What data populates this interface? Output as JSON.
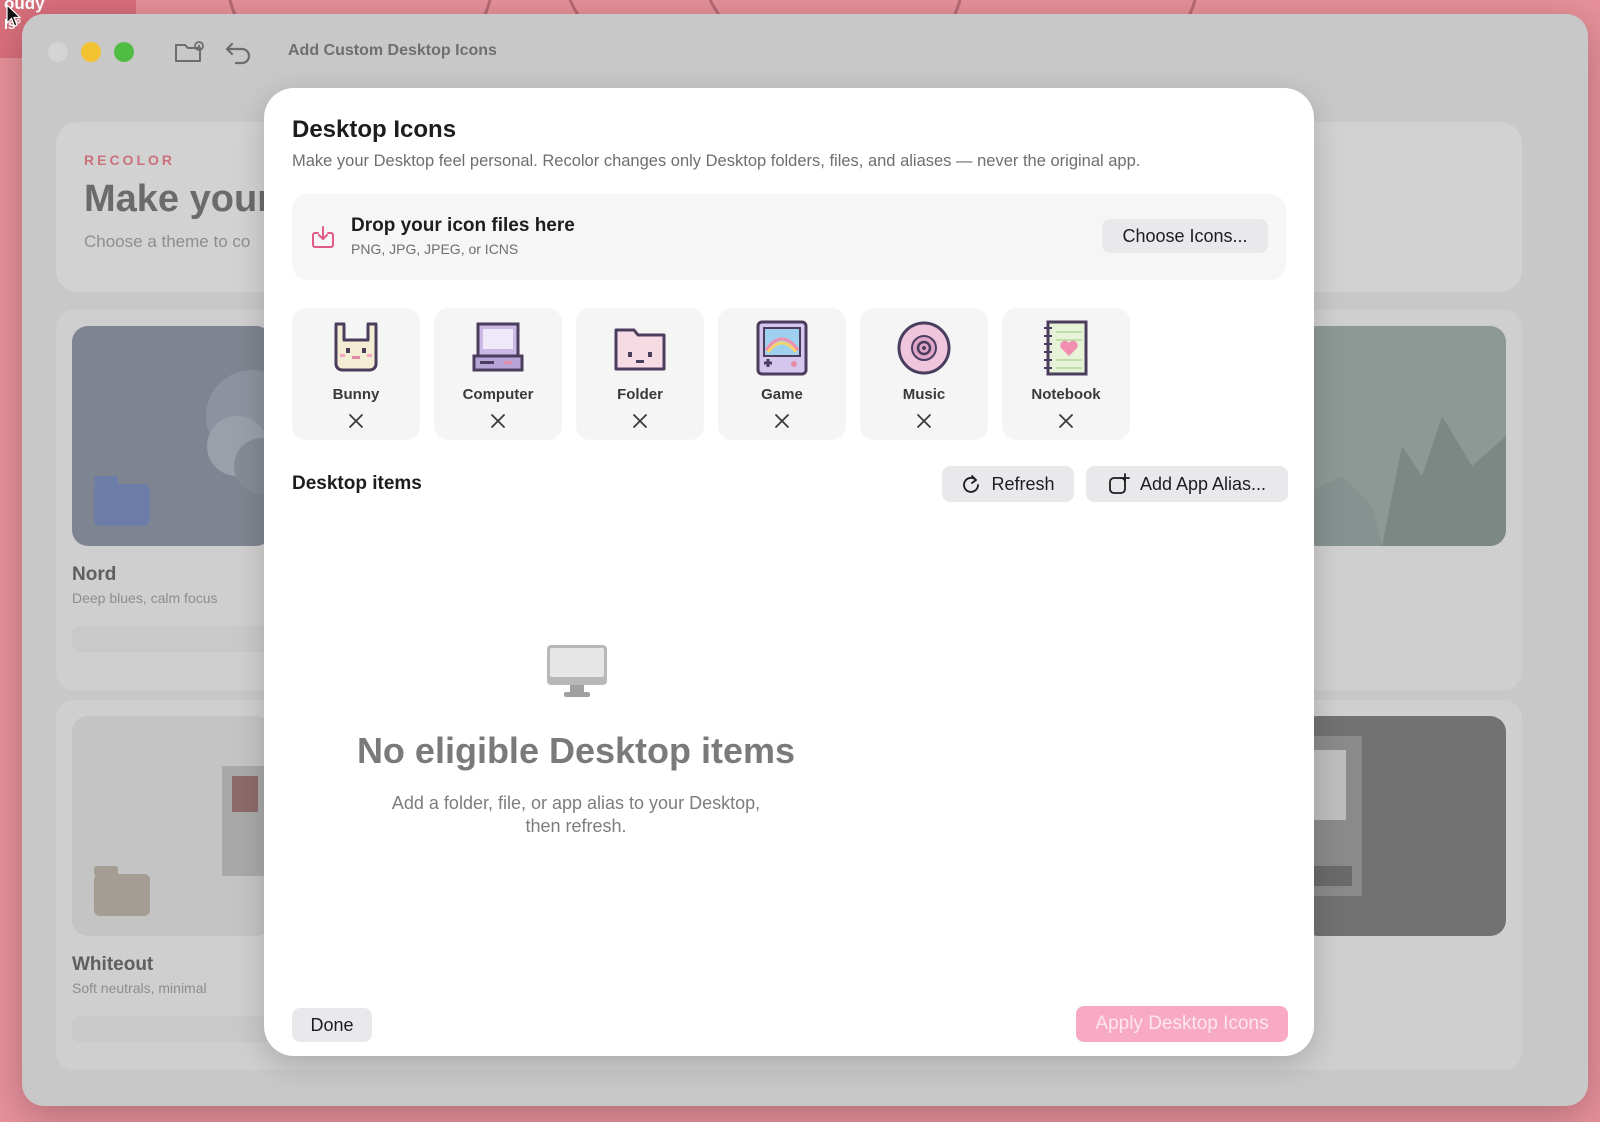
{
  "desktop": {
    "corner_text": "oudy",
    "corner_text2": "ls°"
  },
  "window": {
    "title": "Add Custom Desktop Icons"
  },
  "background": {
    "eyebrow": "RECOLOR",
    "headline": "Make your",
    "subtitle": "Choose a theme to co",
    "themes": [
      {
        "name": "Nord",
        "desc": "Deep blues, calm focus"
      },
      {
        "name": "Whiteout",
        "desc": "Soft neutrals, minimal"
      }
    ]
  },
  "sheet": {
    "title": "Desktop Icons",
    "description": "Make your Desktop feel personal. Recolor changes only Desktop folders, files, and aliases — never the original app.",
    "dropzone": {
      "title": "Drop your icon files here",
      "subtitle": "PNG, JPG, JPEG, or ICNS",
      "choose_label": "Choose Icons..."
    },
    "icons": [
      {
        "label": "Bunny",
        "icon": "bunny-icon"
      },
      {
        "label": "Computer",
        "icon": "computer-icon"
      },
      {
        "label": "Folder",
        "icon": "folder-icon"
      },
      {
        "label": "Game",
        "icon": "game-icon"
      },
      {
        "label": "Music",
        "icon": "music-icon"
      },
      {
        "label": "Notebook",
        "icon": "notebook-icon"
      }
    ],
    "items_section": {
      "title": "Desktop items",
      "refresh_label": "Refresh",
      "alias_label": "Add App Alias..."
    },
    "empty_state": {
      "icon": "desktop-computer-icon",
      "title": "No eligible Desktop items",
      "line1": "Add a folder, file, or app alias to your Desktop,",
      "line2": "then refresh."
    },
    "done_label": "Done",
    "apply_label": "Apply Desktop Icons"
  },
  "colors": {
    "accent": "#e05a8a",
    "apply_disabled": "#f8a9c4",
    "desktop_bg": "#e8919a"
  }
}
